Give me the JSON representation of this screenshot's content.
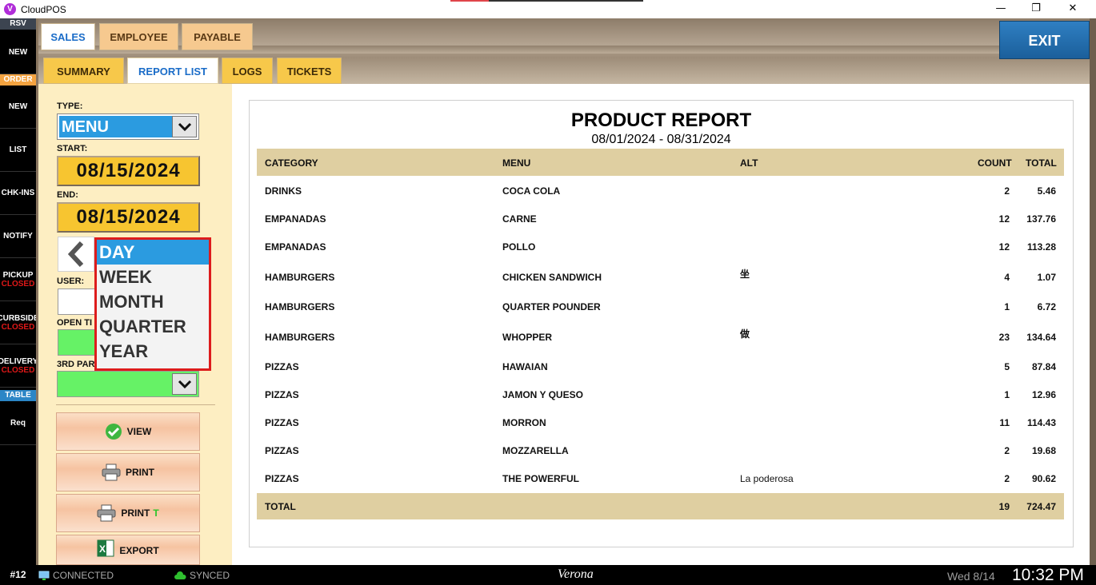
{
  "window": {
    "title": "CloudPOS",
    "logo_letter": "V",
    "minimize": "—",
    "maximize": "❐",
    "close": "✕"
  },
  "sidebar": {
    "rsv_label": "RSV",
    "rsv_new": "NEW",
    "order_label": "ORDER",
    "order_new": "NEW",
    "list": "LIST",
    "chkins": "CHK-INS",
    "notify": "NOTIFY",
    "pickup": "PICKUP",
    "pickup_status": "CLOSED",
    "curbside": "CURBSIDE",
    "curbside_status": "CLOSED",
    "delivery": "DELIVERY",
    "delivery_status": "CLOSED",
    "table_label": "TABLE",
    "req": "Req"
  },
  "main_tabs": [
    {
      "label": "SALES",
      "active": true
    },
    {
      "label": "EMPLOYEE",
      "active": false
    },
    {
      "label": "PAYABLE",
      "active": false
    }
  ],
  "exit_label": "EXIT",
  "sub_tabs": [
    {
      "label": "SUMMARY",
      "active": false
    },
    {
      "label": "REPORT LIST",
      "active": true
    },
    {
      "label": "LOGS",
      "active": false
    },
    {
      "label": "TICKETS",
      "active": false
    }
  ],
  "filters": {
    "type_label": "TYPE:",
    "type_value": "MENU",
    "start_label": "START:",
    "start_date": "08/15/2024",
    "end_label": "END:",
    "end_date": "08/15/2024",
    "user_label": "USER:",
    "open_tickets_label": "OPEN TI",
    "third_party_label": "3RD PAR"
  },
  "period_dropdown": {
    "options": [
      "DAY",
      "WEEK",
      "MONTH",
      "QUARTER",
      "YEAR"
    ],
    "selected": "DAY"
  },
  "actions": {
    "view": "VIEW",
    "print": "PRINT",
    "print_t": "PRINT",
    "print_t_suffix": "T",
    "export": "EXPORT"
  },
  "report": {
    "title": "PRODUCT REPORT",
    "range": "08/01/2024 - 08/31/2024",
    "columns": {
      "category": "CATEGORY",
      "menu": "MENU",
      "alt": "ALT",
      "count": "COUNT",
      "total": "TOTAL"
    },
    "rows": [
      {
        "category": "DRINKS",
        "menu": "COCA COLA",
        "alt": "",
        "count": "2",
        "total": "5.46"
      },
      {
        "category": "EMPANADAS",
        "menu": "CARNE",
        "alt": "",
        "count": "12",
        "total": "137.76"
      },
      {
        "category": "EMPANADAS",
        "menu": "POLLO",
        "alt": "",
        "count": "12",
        "total": "113.28"
      },
      {
        "category": "HAMBURGERS",
        "menu": "CHICKEN SANDWICH",
        "alt": "坐",
        "count": "4",
        "total": "1.07"
      },
      {
        "category": "HAMBURGERS",
        "menu": "QUARTER POUNDER",
        "alt": "",
        "count": "1",
        "total": "6.72"
      },
      {
        "category": "HAMBURGERS",
        "menu": "WHOPPER",
        "alt": "做",
        "count": "23",
        "total": "134.64"
      },
      {
        "category": "PIZZAS",
        "menu": "HAWAIAN",
        "alt": "",
        "count": "5",
        "total": "87.84"
      },
      {
        "category": "PIZZAS",
        "menu": "JAMON Y QUESO",
        "alt": "",
        "count": "1",
        "total": "12.96"
      },
      {
        "category": "PIZZAS",
        "menu": "MORRON",
        "alt": "",
        "count": "11",
        "total": "114.43"
      },
      {
        "category": "PIZZAS",
        "menu": "MOZZARELLA",
        "alt": "",
        "count": "2",
        "total": "19.68"
      },
      {
        "category": "PIZZAS",
        "menu": "THE POWERFUL",
        "alt": "La poderosa",
        "count": "2",
        "total": "90.62"
      }
    ],
    "footer": {
      "label": "TOTAL",
      "count": "19",
      "total": "724.47"
    }
  },
  "status": {
    "station": "#12",
    "connected": "CONNECTED",
    "synced": "SYNCED",
    "store": "Verona",
    "date": "Wed 8/14",
    "time": "10:32 PM"
  },
  "colors": {
    "accent_blue": "#2b9be0",
    "exit_blue": "#1b5f9b",
    "date_yellow": "#f7c530",
    "table_header": "#dfcfa1",
    "closed_red": "#e01818",
    "highlight_border": "#dd1c1c",
    "green_field": "#66f266"
  }
}
